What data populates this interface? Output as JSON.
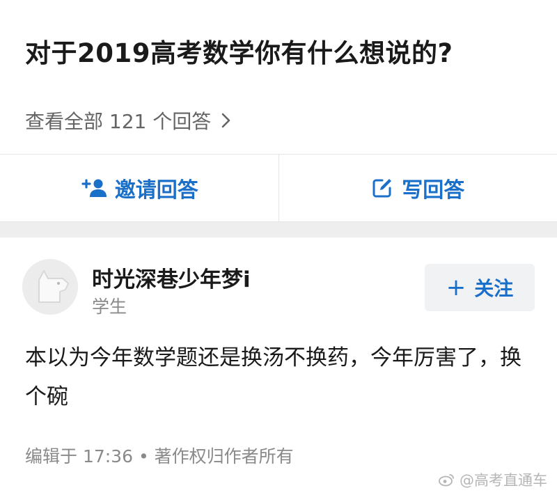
{
  "question": {
    "title": "对于2019高考数学你有什么想说的?",
    "view_all_label": "查看全部 121 个回答"
  },
  "actions": {
    "invite_label": "邀请回答",
    "write_label": "写回答"
  },
  "answer": {
    "author_name": "时光深巷少年梦i",
    "author_tag": "学生",
    "follow_label": "关注",
    "body": "本以为今年数学题还是换汤不换药，今年厉害了，换个碗",
    "meta": "编辑于 17:36 • 著作权归作者所有"
  },
  "watermark": {
    "text": "@高考直通车"
  },
  "colors": {
    "accent": "#1a6fc9",
    "secondary_text": "#8a8a8a",
    "divider": "#e5e5e5",
    "band": "#eeeeee"
  }
}
